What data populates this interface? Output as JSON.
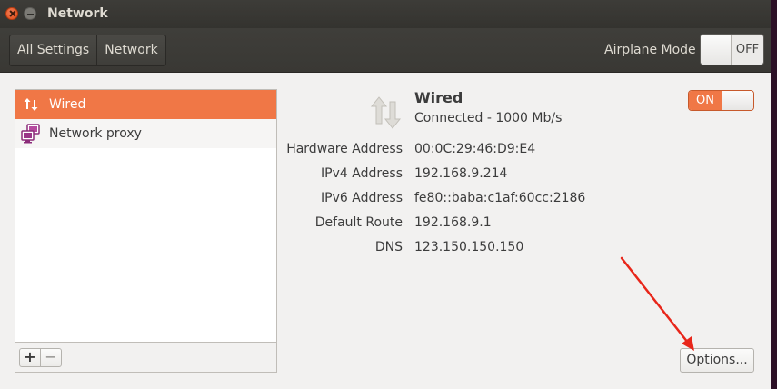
{
  "window": {
    "title": "Network"
  },
  "header": {
    "breadcrumbs": [
      {
        "label": "All Settings"
      },
      {
        "label": "Network"
      }
    ],
    "airplane_mode": {
      "label": "Airplane Mode",
      "state": "OFF"
    }
  },
  "sidebar": {
    "items": [
      {
        "label": "Wired",
        "icon": "wired-arrows-icon",
        "selected": true
      },
      {
        "label": "Network proxy",
        "icon": "network-proxy-icon",
        "selected": false
      }
    ],
    "add_label": "+",
    "remove_label": "−"
  },
  "device": {
    "name": "Wired",
    "status": "Connected - 1000 Mb/s",
    "toggle_state": "ON",
    "details": [
      {
        "label": "Hardware Address",
        "value": "00:0C:29:46:D9:E4"
      },
      {
        "label": "IPv4 Address",
        "value": "192.168.9.214"
      },
      {
        "label": "IPv6 Address",
        "value": "fe80::baba:c1af:60cc:2186"
      },
      {
        "label": "Default Route",
        "value": "192.168.9.1"
      },
      {
        "label": "DNS",
        "value": "123.150.150.150"
      }
    ],
    "options_label": "Options..."
  },
  "colors": {
    "accent": "#f07746",
    "annotation_arrow": "#e8261a"
  }
}
